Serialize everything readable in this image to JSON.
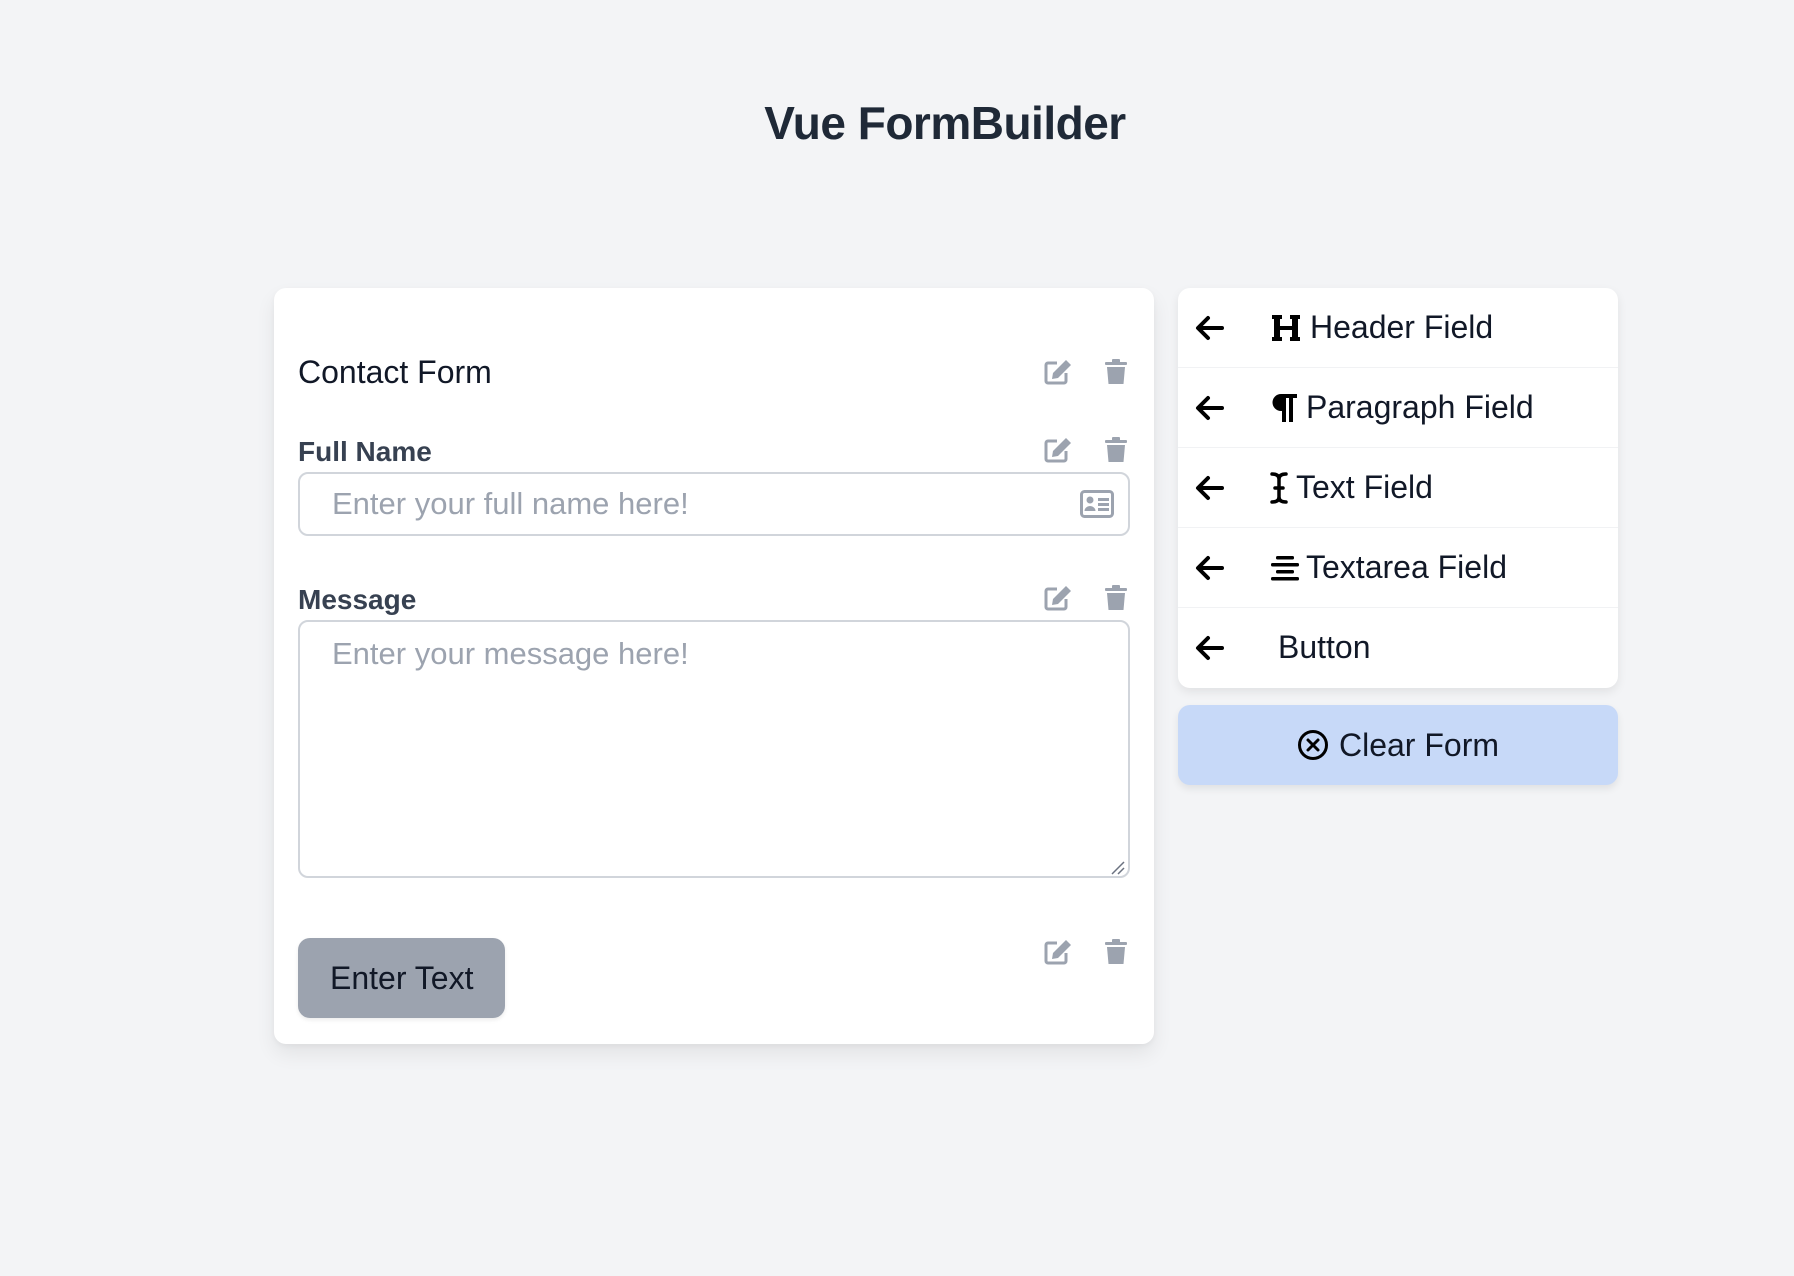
{
  "app": {
    "title": "Vue FormBuilder"
  },
  "form": {
    "header": {
      "text": "Contact Form"
    },
    "full_name": {
      "label": "Full Name",
      "placeholder": "Enter your full name here!"
    },
    "message": {
      "label": "Message",
      "placeholder": "Enter your message here!"
    },
    "button": {
      "label": "Enter Text"
    }
  },
  "palette": {
    "items": [
      {
        "label": "Header Field",
        "icon": "heading-icon"
      },
      {
        "label": "Paragraph Field",
        "icon": "paragraph-icon"
      },
      {
        "label": "Text Field",
        "icon": "text-cursor-icon"
      },
      {
        "label": "Textarea Field",
        "icon": "align-center-icon"
      },
      {
        "label": "Button",
        "icon": ""
      }
    ],
    "clear_label": "Clear Form"
  },
  "colors": {
    "background": "#f3f4f6",
    "clear_button": "#c7d9f8",
    "form_button": "#9ca3af",
    "action_icon": "#9ca3af"
  }
}
